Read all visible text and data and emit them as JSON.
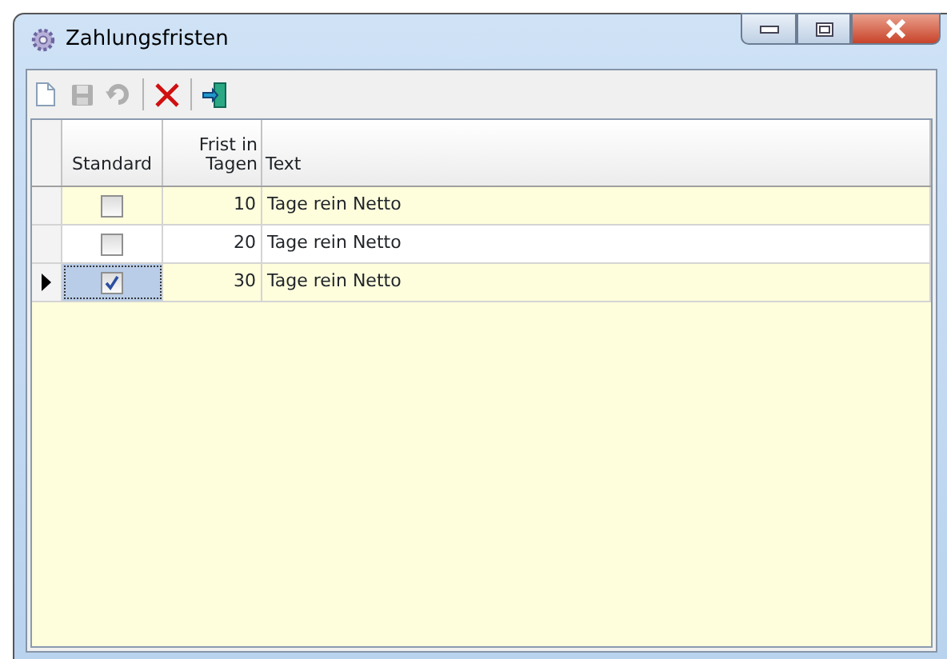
{
  "window": {
    "title": "Zahlungsfristen"
  },
  "toolbar": [
    {
      "kind": "new",
      "disabled": false
    },
    {
      "kind": "save",
      "disabled": true
    },
    {
      "kind": "undo",
      "disabled": true
    },
    {
      "kind": "delete",
      "disabled": false
    },
    {
      "kind": "exit",
      "disabled": false
    }
  ],
  "table": {
    "columns": [
      "Standard",
      "Frist in Tagen",
      "Text"
    ],
    "rows": [
      {
        "checked": false,
        "days": "10",
        "text": "Tage rein Netto",
        "selected": false
      },
      {
        "checked": false,
        "days": "20",
        "text": "Tage rein Netto",
        "selected": false
      },
      {
        "checked": true,
        "days": "30",
        "text": "Tage rein Netto",
        "selected": true
      }
    ]
  }
}
